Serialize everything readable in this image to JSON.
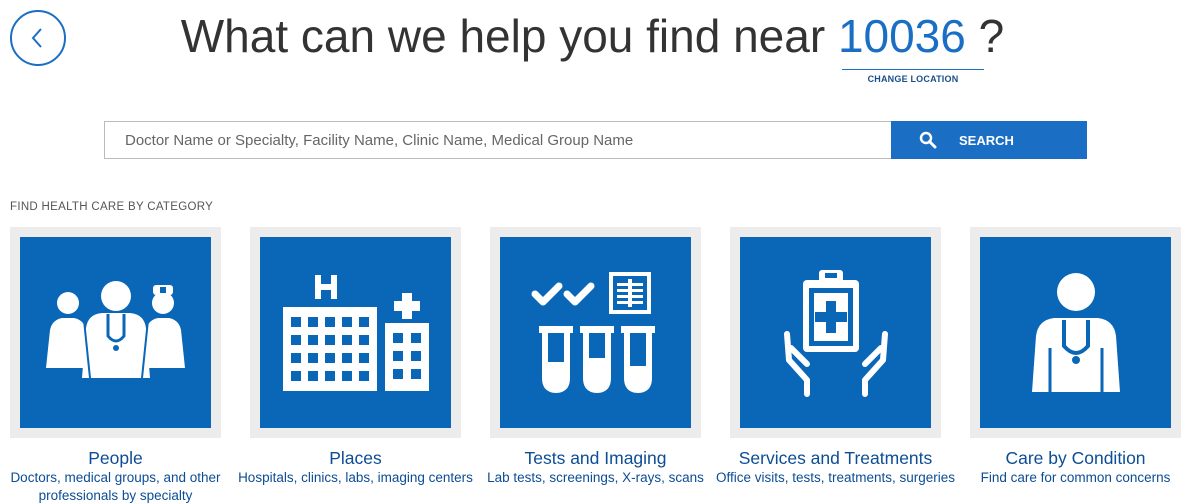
{
  "header": {
    "question_prefix": "What can we help you find near",
    "zip": "10036",
    "question_suffix": "?",
    "change_location": "CHANGE LOCATION"
  },
  "search": {
    "placeholder": "Doctor Name or Specialty, Facility Name, Clinic Name, Medical Group Name",
    "button_label": "SEARCH"
  },
  "categories_label": "FIND HEALTH CARE BY CATEGORY",
  "categories": [
    {
      "title": "People",
      "description": "Doctors, medical groups, and other professionals by specialty",
      "icon": "people-icon"
    },
    {
      "title": "Places",
      "description": "Hospitals, clinics, labs, imaging centers",
      "icon": "hospital-icon"
    },
    {
      "title": "Tests and Imaging",
      "description": "Lab tests, screenings, X-rays, scans",
      "icon": "test-tubes-icon"
    },
    {
      "title": "Services and Treatments",
      "description": "Office visits, tests, treatments, surgeries",
      "icon": "clipboard-hands-icon"
    },
    {
      "title": "Care by Condition",
      "description": "Find care for common concerns",
      "icon": "doctor-icon"
    }
  ],
  "colors": {
    "accent": "#1a6fc4",
    "tile": "#0a66b7",
    "text_link": "#0c4d94"
  }
}
